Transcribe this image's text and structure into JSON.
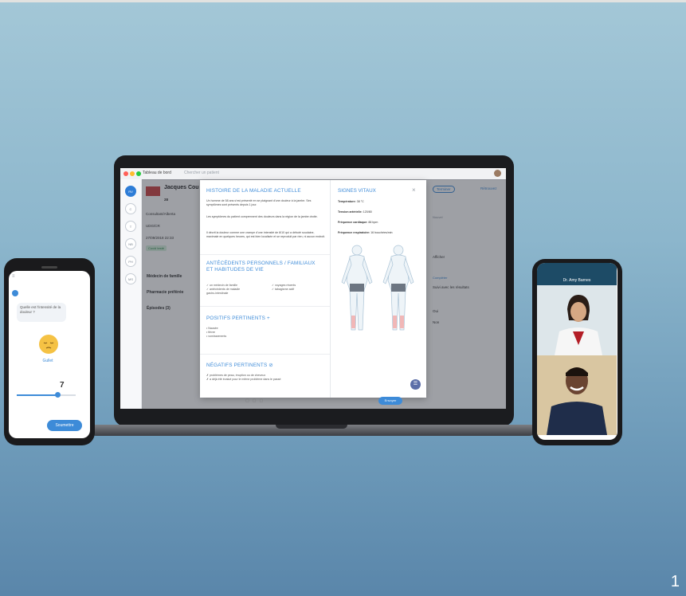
{
  "slide_number": "1",
  "app": {
    "titlebar": {
      "tab": "Tableau de bord",
      "search_placeholder": "Chercher un patient"
    },
    "nav": [
      "RV",
      "C",
      "T",
      "NB",
      "PH",
      "MS"
    ],
    "patient": {
      "name": "Jacques Cou",
      "age": "28",
      "meta": "Consultant/Alberta",
      "insurer": "UDG/CR",
      "date": "27/09/2018 22:33",
      "tag": "Covid testé",
      "sections": [
        "Médecin de famille",
        "Pharmacie préférée",
        "Épisodes (3)"
      ]
    },
    "right": {
      "toolbar": [
        "Terminer",
        "Rétrouvez"
      ],
      "items": [
        "Nouvel",
        "Afficher",
        "Compléter",
        "Suivi avec les résultats",
        "Oui",
        "Non"
      ]
    }
  },
  "modal": {
    "hpi_title": "HISTOIRE DE LA MALADIE ACTUELLE",
    "hpi_p1": "Un homme de 58 ans s'est présenté en se plaignant d'une douleur à la jambe. Ses symptômes sont présents depuis 1 jour.",
    "hpi_p2": "Les symptômes du patient comprennent des douleurs dans la région de la jambe droite.",
    "hpi_p3": "Il décrit la douleur comme une crampe d'une intensité de 8/10 qui a débuté soudaine, maximale en quelques heures, qui est bien localisée et se reproduit par rien, ni aucun endroit.",
    "past_title": "ANTÉCÉDENTS PERSONNELS / FAMILIAUX ET HABITUDES DE VIE",
    "past_col1": [
      "✓ un médecin de famille",
      "✓ antécédents de maladie",
      "gastro-intestinale"
    ],
    "past_col2": [
      "✓ voyages récents",
      "✓ tabagisme actif"
    ],
    "pos_title": "POSITIFS PERTINENTS +",
    "pos_items": [
      "• Nausée",
      "• fièvre",
      "• vomissements"
    ],
    "neg_title": "NÉGATIFS PERTINENTS ⊘",
    "neg_items": [
      "✗ problèmes de peau, éruption ou de cheveux",
      "✗ a déjà été évalué pour le même problème dans le passé"
    ],
    "vitals_title": "SIGNES VITAUX",
    "close": "×",
    "vitals": [
      {
        "label": "Température:",
        "value": "38 °C"
      },
      {
        "label": "Tension artérielle:",
        "value": "120/80"
      },
      {
        "label": "Fréquence cardiaque:",
        "value": "88 bpm"
      },
      {
        "label": "Fréquence respiratoire:",
        "value": "16 bouchées/min"
      }
    ],
    "send_button": "Envoyer"
  },
  "left_phone": {
    "question": "Quelle est l'intensité de la douleur ?",
    "label": "Gullet",
    "value": "7",
    "slider_level": 0.7,
    "submit": "Soumettre"
  },
  "right_phone": {
    "header": "Dr. Amy Barnes"
  }
}
